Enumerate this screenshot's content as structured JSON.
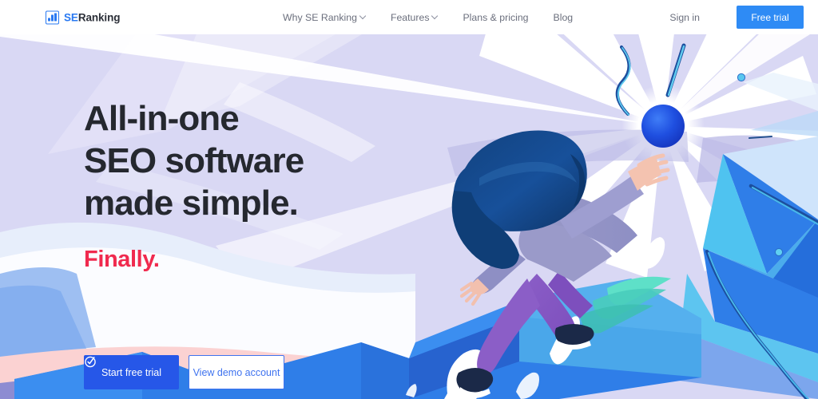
{
  "header": {
    "logo": {
      "icon": "bar-chart-icon",
      "text_primary": "SE",
      "text_secondary": "Ranking"
    },
    "nav": [
      {
        "label": "Why SE Ranking",
        "has_caret": true
      },
      {
        "label": "Features",
        "has_caret": true
      },
      {
        "label": "Plans & pricing",
        "has_caret": false
      },
      {
        "label": "Blog",
        "has_caret": false
      }
    ],
    "sign_in_label": "Sign in",
    "free_trial_label": "Free trial"
  },
  "hero": {
    "headline_line1": "All-in-one",
    "headline_line2": "SEO software",
    "headline_line3": "made simple.",
    "tagline": "Finally.",
    "primary_cta": "Start free trial",
    "primary_cta_icon": "check-circle-icon",
    "secondary_cta": "View demo account"
  },
  "colors": {
    "brand_blue": "#2979f2",
    "header_button_blue": "#2e8bf5",
    "cta_blue": "#2657e8",
    "outline_blue": "#3f73ef",
    "accent_red": "#f02a4e",
    "headline_dark": "#25282f",
    "nav_gray": "#6b6f7d",
    "hero_lavender": "#d9d8f4"
  }
}
